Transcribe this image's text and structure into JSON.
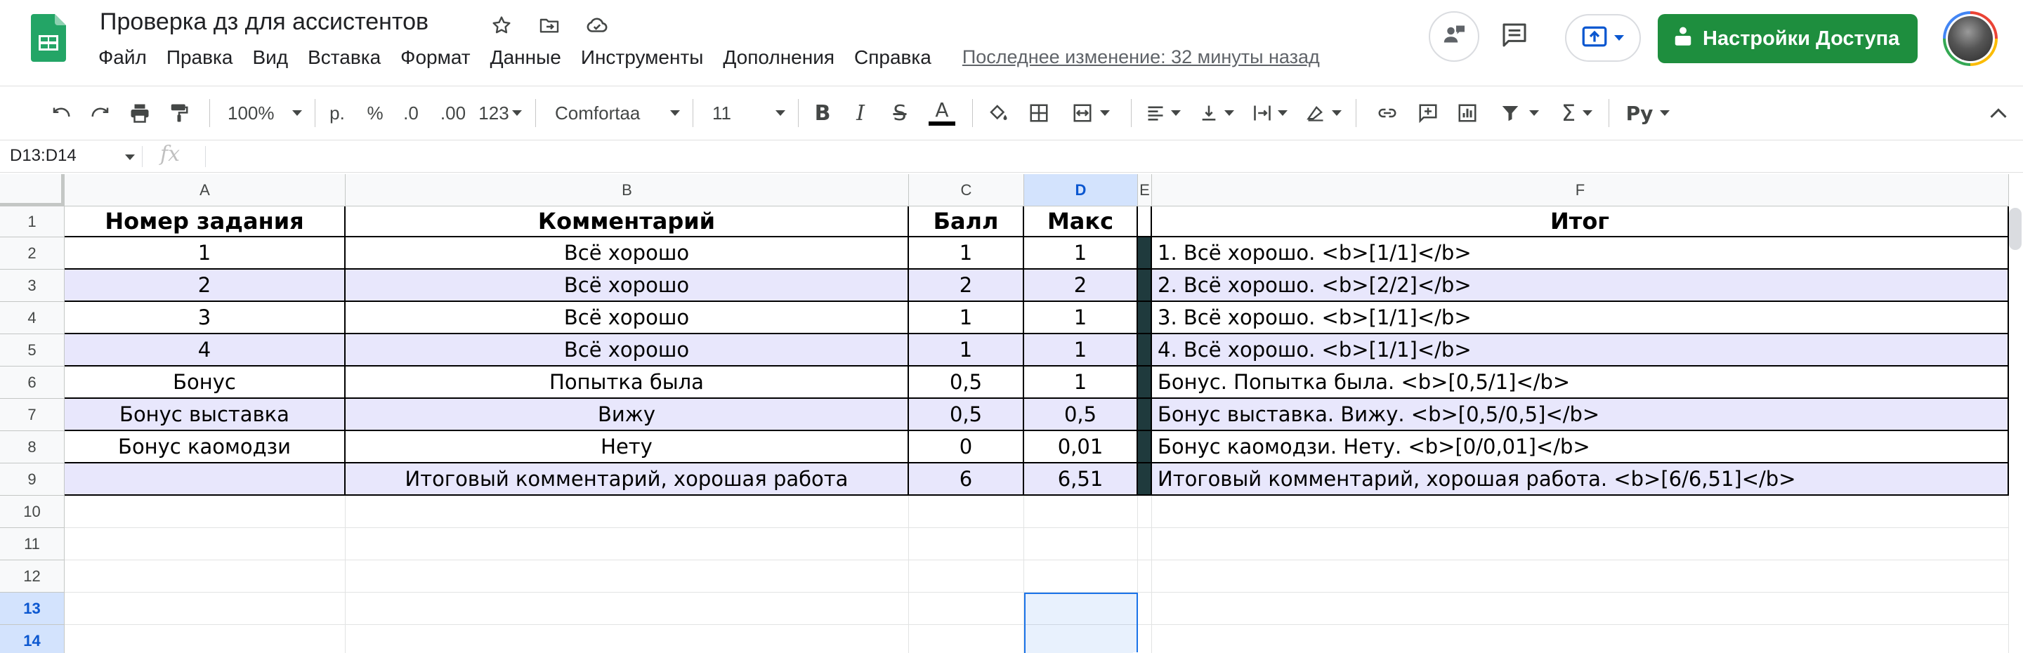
{
  "app": {
    "title": "Проверка дз для ассистентов",
    "title_icons": [
      "star-icon",
      "move-to-folder-icon",
      "cloud-saved-icon"
    ]
  },
  "menu": {
    "items": [
      "Файл",
      "Правка",
      "Вид",
      "Вставка",
      "Формат",
      "Данные",
      "Инструменты",
      "Дополнения",
      "Справка"
    ],
    "last_edit": "Последнее изменение: 32 минуты назад"
  },
  "header_right": {
    "share_label": "Настройки Доступа",
    "share_color": "#1e8e3e"
  },
  "toolbar": {
    "zoom": "100%",
    "currency": "р.",
    "percent": "%",
    "dec_decrease": ".0",
    "dec_increase": ".00",
    "more_formats": "123",
    "font": "Comfortaa",
    "font_size": "11",
    "text_color_bar": "#000000"
  },
  "formula_bar": {
    "name_box": "D13:D14",
    "fx": "fx",
    "content": ""
  },
  "sheet": {
    "columns": [
      "A",
      "B",
      "C",
      "D",
      "E",
      "F"
    ],
    "selected_column": "D",
    "row_numbers": [
      "1",
      "2",
      "3",
      "4",
      "5",
      "6",
      "7",
      "8",
      "9",
      "10",
      "11",
      "12",
      "13",
      "14"
    ],
    "selected_rows": [
      "13",
      "14"
    ],
    "header_row": [
      "Номер задания",
      "Комментарий",
      "Балл",
      "Макс",
      "",
      "Итог"
    ],
    "rows": [
      [
        "1",
        "Всё хорошо",
        "1",
        "1",
        "",
        "1. Всё хорошо. <b>[1/1]</b>"
      ],
      [
        "2",
        "Всё хорошо",
        "2",
        "2",
        "",
        "2. Всё хорошо. <b>[2/2]</b>"
      ],
      [
        "3",
        "Всё хорошо",
        "1",
        "1",
        "",
        "3. Всё хорошо. <b>[1/1]</b>"
      ],
      [
        "4",
        "Всё хорошо",
        "1",
        "1",
        "",
        "4. Всё хорошо. <b>[1/1]</b>"
      ],
      [
        "Бонус",
        "Попытка была",
        "0,5",
        "1",
        "",
        "Бонус. Попытка была. <b>[0,5/1]</b>"
      ],
      [
        "Бонус выставка",
        "Вижу",
        "0,5",
        "0,5",
        "",
        "Бонус выставка. Вижу. <b>[0,5/0,5]</b>"
      ],
      [
        "Бонус каомодзи",
        "Нету",
        "0",
        "0,01",
        "",
        "Бонус каомодзи. Нету. <b>[0/0,01]</b>"
      ],
      [
        "",
        "Итоговый комментарий, хорошая работа",
        "6",
        "6,51",
        "",
        "Итоговый комментарий, хорошая работа. <b>[6/6,51]</b>"
      ]
    ],
    "band_color": "#e8e7fc",
    "column_e_fill": "#1f3a3d",
    "selection_color": "#1a73e8"
  }
}
